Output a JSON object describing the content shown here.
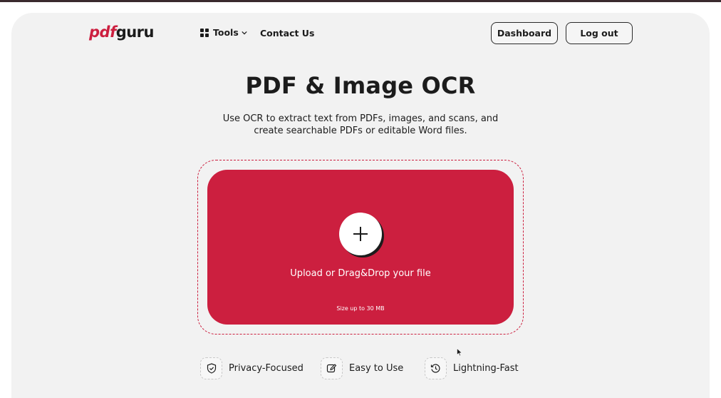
{
  "brand": {
    "logo_part1": "pdf",
    "logo_part2": "guru",
    "accent_color": "#cc1f3f"
  },
  "nav": {
    "tools_label": "Tools",
    "contact_label": "Contact Us",
    "dashboard_label": "Dashboard",
    "logout_label": "Log out"
  },
  "hero": {
    "title": "PDF & Image OCR",
    "subtitle": "Use OCR to extract text from PDFs, images, and scans, and create searchable PDFs or editable Word files."
  },
  "upload": {
    "label": "Upload or Drag&Drop your file",
    "size_note": "Size up to 30 MB"
  },
  "features": [
    {
      "icon": "shield-check-icon",
      "label": "Privacy-Focused"
    },
    {
      "icon": "edit-icon",
      "label": "Easy to Use"
    },
    {
      "icon": "clock-icon",
      "label": "Lightning-Fast"
    }
  ]
}
